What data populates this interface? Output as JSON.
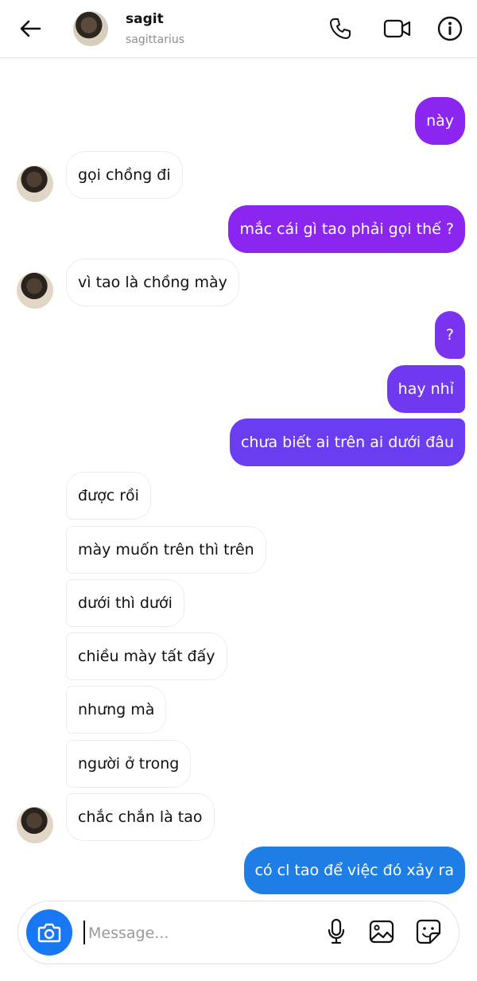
{
  "header": {
    "name": "sagit",
    "username": "sagittarius",
    "back_icon": "arrow-left-icon",
    "call_icon": "phone-icon",
    "video_icon": "video-camera-icon",
    "info_icon": "info-icon"
  },
  "colors": {
    "accent_blue": "#1877f2",
    "bubble_purple": "#8a26f0",
    "bubble_indigo": "#6a3df0",
    "bubble_blue": "#1e7ee6"
  },
  "messages": [
    {
      "side": "out",
      "text": "này"
    },
    {
      "side": "in",
      "text": "gọi chồng đi"
    },
    {
      "side": "out",
      "text": "mắc cái gì tao phải gọi thế ?"
    },
    {
      "side": "in",
      "text": "vì tao là chồng mày"
    },
    {
      "side": "out",
      "text": "?"
    },
    {
      "side": "out",
      "text": "hay nhỉ"
    },
    {
      "side": "out",
      "text": "chưa biết ai trên ai dưới đâu"
    },
    {
      "side": "in",
      "text": "được rồi"
    },
    {
      "side": "in",
      "text": "mày muốn trên thì trên"
    },
    {
      "side": "in",
      "text": "dưới thì dưới"
    },
    {
      "side": "in",
      "text": "chiều mày tất đấy"
    },
    {
      "side": "in",
      "text": "nhưng mà"
    },
    {
      "side": "in",
      "text": "người ở trong"
    },
    {
      "side": "in",
      "text": "chắc chắn là tao"
    },
    {
      "side": "out",
      "text": "có cl tao để việc đó xảy ra"
    }
  ],
  "composer": {
    "placeholder": "Message...",
    "camera_icon": "camera-icon",
    "mic_icon": "microphone-icon",
    "gallery_icon": "image-icon",
    "sticker_icon": "sticker-icon"
  }
}
